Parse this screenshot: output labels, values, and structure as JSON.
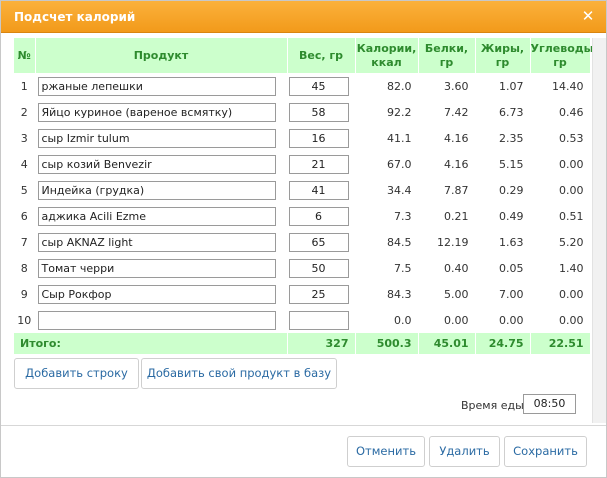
{
  "dialog": {
    "title": "Подсчет калорий"
  },
  "table": {
    "headers": [
      "№",
      "Продукт",
      "Вес, гр",
      "Калории,\nккал",
      "Белки,\nгр",
      "Жиры, гр",
      "Углеводы,\nгр"
    ],
    "rows": [
      {
        "n": "1",
        "product": "ржаные лепешки",
        "weight": "45",
        "cal": "82.0",
        "prot": "3.60",
        "fat": "1.07",
        "carb": "14.40"
      },
      {
        "n": "2",
        "product": "Яйцо куриное (вареное всмятку)",
        "weight": "58",
        "cal": "92.2",
        "prot": "7.42",
        "fat": "6.73",
        "carb": "0.46"
      },
      {
        "n": "3",
        "product": "сыр Izmir tulum",
        "weight": "16",
        "cal": "41.1",
        "prot": "4.16",
        "fat": "2.35",
        "carb": "0.53"
      },
      {
        "n": "4",
        "product": "сыр козий Benvezir",
        "weight": "21",
        "cal": "67.0",
        "prot": "4.16",
        "fat": "5.15",
        "carb": "0.00"
      },
      {
        "n": "5",
        "product": "Индейка (грудка)",
        "weight": "41",
        "cal": "34.4",
        "prot": "7.87",
        "fat": "0.29",
        "carb": "0.00"
      },
      {
        "n": "6",
        "product": "аджика Acili Ezme",
        "weight": "6",
        "cal": "7.3",
        "prot": "0.21",
        "fat": "0.49",
        "carb": "0.51"
      },
      {
        "n": "7",
        "product": "сыр AKNAZ light",
        "weight": "65",
        "cal": "84.5",
        "prot": "12.19",
        "fat": "1.63",
        "carb": "5.20"
      },
      {
        "n": "8",
        "product": "Томат черри",
        "weight": "50",
        "cal": "7.5",
        "prot": "0.40",
        "fat": "0.05",
        "carb": "1.40"
      },
      {
        "n": "9",
        "product": "Сыр Рокфор",
        "weight": "25",
        "cal": "84.3",
        "prot": "5.00",
        "fat": "7.00",
        "carb": "0.00"
      },
      {
        "n": "10",
        "product": "",
        "weight": "",
        "cal": "0.0",
        "prot": "0.00",
        "fat": "0.00",
        "carb": "0.00"
      }
    ],
    "total": {
      "label": "Итого:",
      "weight": "327",
      "cal": "500.3",
      "prot": "45.01",
      "fat": "24.75",
      "carb": "22.51"
    }
  },
  "actions": {
    "add_row": "Добавить строку",
    "add_product": "Добавить свой продукт в базу"
  },
  "meal_time": {
    "label": "Время еды:",
    "value": "08:50"
  },
  "footer": {
    "cancel": "Отменить",
    "delete": "Удалить",
    "save": "Сохранить"
  }
}
